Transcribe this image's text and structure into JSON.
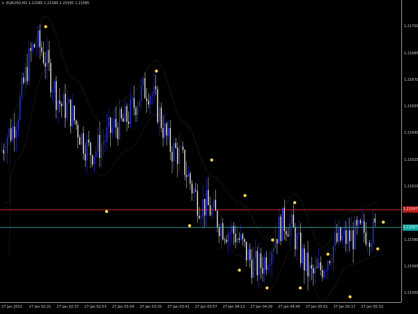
{
  "header": {
    "symbol": "EURUSD,M1",
    "ohlc": "1.21585 1.21585 1.21585 1.21585"
  },
  "price_axis": {
    "labels": [
      "1.21700",
      "1.21685",
      "1.21670",
      "1.21655",
      "1.21640",
      "1.21625",
      "1.21610",
      "1.21580",
      "1.21565",
      "1.21550"
    ],
    "bid_tag": "1.21597",
    "ask_tag": "1.21587"
  },
  "time_axis": {
    "labels": [
      "27 Jan 2021",
      "27 Jan 02:21",
      "27 Jan 02:37",
      "27 Jan 02:53",
      "27 Jan 03:09",
      "27 Jan 03:25",
      "27 Jan 03:41",
      "27 Jan 03:57",
      "27 Jan 04:13",
      "27 Jan 04:29",
      "27 Jan 04:45",
      "27 Jan 05:01",
      "27 Jan 05:17",
      "27 Jan 05:33"
    ]
  },
  "colors": {
    "background": "#000000",
    "bull_bar": "#2f3cff",
    "bear_bar": "#ffffff",
    "bid_line": "#ff3b3b",
    "ask_line": "#3fc9c2",
    "bid_tag": "#c01818",
    "ask_tag": "#10a6a0",
    "signal_dot": "#ffd54a"
  },
  "chart_data": {
    "type": "candlestick",
    "x": [
      "27 Jan 2021",
      "27 Jan 02:21",
      "27 Jan 02:37",
      "27 Jan 02:53",
      "27 Jan 03:09",
      "27 Jan 03:25",
      "27 Jan 03:41",
      "27 Jan 03:57",
      "27 Jan 04:13",
      "27 Jan 04:29",
      "27 Jan 04:45",
      "27 Jan 05:01",
      "27 Jan 05:17",
      "27 Jan 05:33"
    ],
    "close": [
      1.2164,
      1.2169,
      1.21655,
      1.2163,
      1.21645,
      1.21665,
      1.2163,
      1.216,
      1.21585,
      1.21565,
      1.2159,
      1.2156,
      1.2158,
      1.21585
    ],
    "y_range": [
      1.21545,
      1.21715
    ],
    "bid": 1.21597,
    "ask": 1.21587,
    "signal_points": [
      {
        "x": "27 Jan 02:21",
        "y": 1.217
      },
      {
        "x": "27 Jan 02:53",
        "y": 1.21596
      },
      {
        "x": "27 Jan 03:25",
        "y": 1.21675
      },
      {
        "x": "27 Jan 03:41",
        "y": 1.21588
      },
      {
        "x": "27 Jan 03:57",
        "y": 1.21625
      },
      {
        "x": "27 Jan 04:13",
        "y": 1.21605
      },
      {
        "x": "27 Jan 04:13",
        "y": 1.21563
      },
      {
        "x": "27 Jan 04:29",
        "y": 1.2158
      },
      {
        "x": "27 Jan 04:29",
        "y": 1.21553
      },
      {
        "x": "27 Jan 04:45",
        "y": 1.21553
      },
      {
        "x": "27 Jan 04:45",
        "y": 1.21601
      },
      {
        "x": "27 Jan 05:01",
        "y": 1.21572
      },
      {
        "x": "27 Jan 05:17",
        "y": 1.21548
      },
      {
        "x": "27 Jan 05:33",
        "y": 1.2159
      },
      {
        "x": "27 Jan 05:33",
        "y": 1.21575
      }
    ],
    "grid": false
  }
}
